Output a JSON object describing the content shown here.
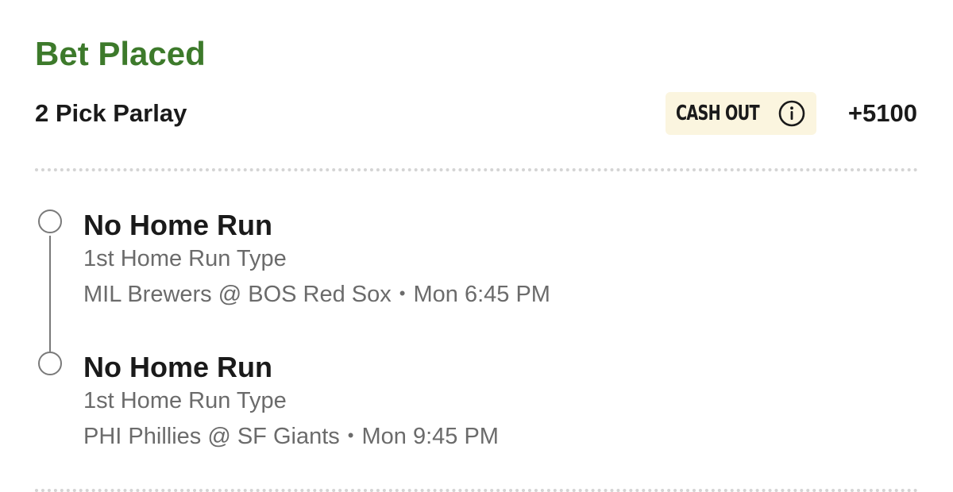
{
  "header": {
    "title": "Bet Placed",
    "bet_type": "2 Pick Parlay",
    "cash_out_label": "CASH OUT",
    "odds": "+5100"
  },
  "picks": [
    {
      "selection": "No Home Run",
      "market": "1st Home Run Type",
      "matchup": "MIL Brewers @ BOS Red Sox",
      "time": "Mon 6:45 PM"
    },
    {
      "selection": "No Home Run",
      "market": "1st Home Run Type",
      "matchup": "PHI Phillies @ SF Giants",
      "time": "Mon 9:45 PM"
    }
  ],
  "colors": {
    "title_green": "#3d7a2b",
    "cash_out_bg": "#fbf5df",
    "secondary_text": "#6b6b6b",
    "timeline": "#7a7a7a"
  },
  "icons": {
    "cash_out_info": "info-circle-icon",
    "pick_status": "open-circle-icon"
  }
}
